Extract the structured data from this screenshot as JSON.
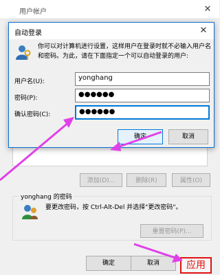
{
  "background_window": {
    "title": "用户帐户",
    "close_glyph": "✕",
    "buttons": {
      "add": "添加(D)...",
      "remove": "删除(R)",
      "properties": "属性(O)"
    },
    "password_group": {
      "label": "yonghang 的密码",
      "text": "要更改密码，按 Ctrl-Alt-Del 并选择\"更改密码\"。",
      "reset_button": "重置密码(P)..."
    },
    "ok": "确定",
    "cancel": "取消",
    "apply": "应用"
  },
  "dialog": {
    "title": "自动登录",
    "close_glyph": "✕",
    "description": "你可以对计算机进行设置，这样用户在登录时就不必输入用户名和密码。为此，请在下面指定一个可以自动登录的用户:",
    "fields": {
      "username_label": "用户名(U):",
      "username_value": "yonghang",
      "password_label": "密码(P):",
      "password_value": "●●●●●●",
      "confirm_label": "确认密码(C):",
      "confirm_value": "●●●●●●"
    },
    "ok": "确定",
    "cancel": "取消"
  },
  "colors": {
    "accent": "#0078d7",
    "arrow": "#e040e8",
    "highlight": "#e01010"
  },
  "icons": [
    "user-icon",
    "key-icon",
    "users-icon",
    "close-icon"
  ]
}
